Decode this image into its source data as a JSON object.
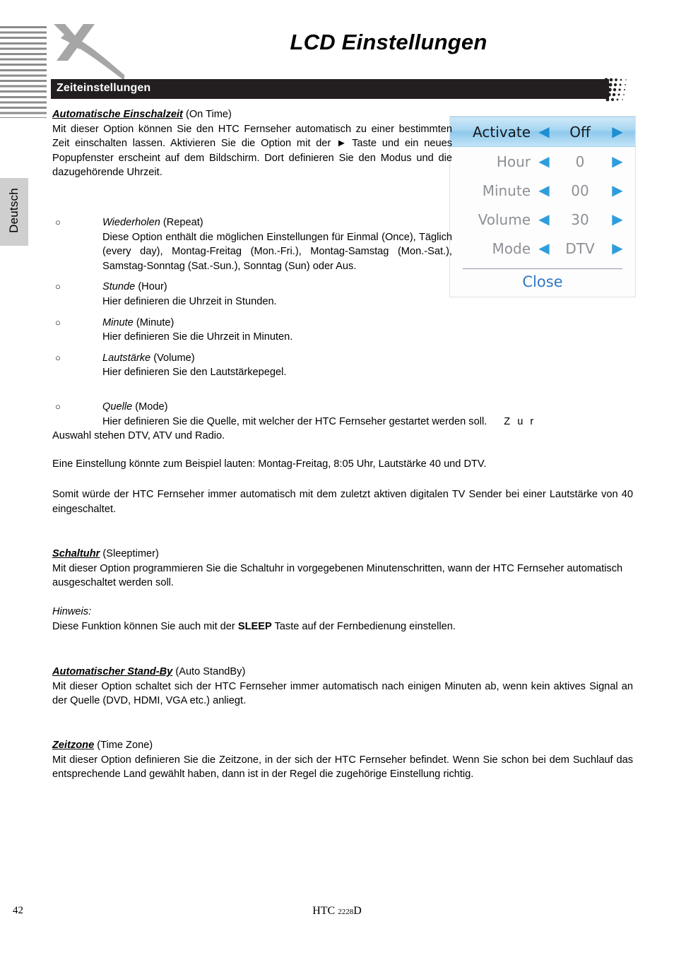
{
  "page": {
    "title": "LCD Einstellungen",
    "section_bar_label": "Zeiteinstellungen",
    "language_tab": "Deutsch",
    "logo_letter": "X"
  },
  "footer": {
    "page_number": "42",
    "model_prefix": "HTC",
    "model_number": "2228",
    "model_suffix": "D"
  },
  "sections": {
    "on_time": {
      "heading": "Automatische Einschalzeit",
      "heading_en": " (On Time)",
      "body": "Mit dieser Option können Sie den HTC Fernseher automatisch zu einer bestimmten Zeit einschalten lassen. Aktivieren Sie die Option mit der ► Taste und ein neues Popupfenster erscheint auf dem Bildschirm. Dort definieren Sie den Modus und die dazugehörende Uhrzeit."
    },
    "bullets": [
      {
        "term": "Wiederholen",
        "term_en": " (Repeat)",
        "text": "Diese Option enthält die möglichen Einstellungen für Einmal (Once), Täglich (every day), Montag-Freitag (Mon.-Fri.), Montag-Samstag (Mon.-Sat.), Samstag-Sonntag (Sat.-Sun.), Sonntag (Sun) oder Aus."
      },
      {
        "term": "Stunde",
        "term_en": " (Hour)",
        "text": "Hier definieren die Uhrzeit in Stunden."
      },
      {
        "term": "Minute",
        "term_en": " (Minute)",
        "text": "Hier definieren Sie die Uhrzeit in Minuten."
      },
      {
        "term": "Lautstärke",
        "term_en": " (Volume)",
        "text": "Hier definieren Sie den Lautstärkepegel."
      }
    ],
    "mode_bullet": {
      "term": "Quelle",
      "term_en": " (Mode)",
      "line1": "Hier definieren Sie die Quelle, mit welcher der HTC Fernseher gestartet werden soll.",
      "line1_tail": "Z u r",
      "line2": "Auswahl stehen DTV, ATV und Radio."
    },
    "example": "Eine Einstellung könnte zum Beispiel lauten: Montag-Freitag, 8:05 Uhr, Lautstärke 40 und DTV.",
    "summary": "Somit würde der HTC Fernseher immer automatisch mit dem zuletzt aktiven digitalen TV Sender bei einer Lautstärke von 40 eingeschaltet.",
    "sleeptimer": {
      "heading": "Schaltuhr",
      "heading_en": " (Sleeptimer)",
      "body": "Mit dieser Option programmieren Sie die Schaltuhr in vorgegebenen Minutenschritten, wann der HTC Fernseher automatisch ausgeschaltet werden soll.",
      "note_label": "Hinweis:",
      "note_pre": "Diese Funktion können Sie auch mit der ",
      "note_bold": "SLEEP",
      "note_post": " Taste auf der Fernbedienung einstellen."
    },
    "standby": {
      "heading": "Automatischer Stand-By",
      "heading_en": " (Auto StandBy)",
      "body": "Mit dieser Option schaltet sich der HTC Fernseher immer automatisch nach einigen Minuten ab, wenn kein aktives Signal an der Quelle (DVD, HDMI, VGA etc.) anliegt."
    },
    "timezone": {
      "heading": "Zeitzone",
      "heading_en": " (Time Zone)",
      "body": "Mit dieser Option definieren Sie die Zeitzone, in der sich der HTC Fernseher befindet. Wenn Sie schon bei dem Suchlauf das entsprechende Land gewählt haben, dann ist in der Regel die zugehörige Einstellung richtig."
    }
  },
  "osd": {
    "rows": [
      {
        "label": "Activate",
        "value": "Off",
        "selected": true
      },
      {
        "label": "Hour",
        "value": "0",
        "selected": false
      },
      {
        "label": "Minute",
        "value": "00",
        "selected": false
      },
      {
        "label": "Volume",
        "value": "30",
        "selected": false
      },
      {
        "label": "Mode",
        "value": "DTV",
        "selected": false
      }
    ],
    "close_label": "Close",
    "left_arrow": "◀",
    "right_arrow": "▶",
    "colors": {
      "accent_blue": "#2f9ddb",
      "close_blue": "#2f78c4",
      "selected_highlight": "#a9d7f2",
      "label_gray": "#8d9095"
    }
  }
}
